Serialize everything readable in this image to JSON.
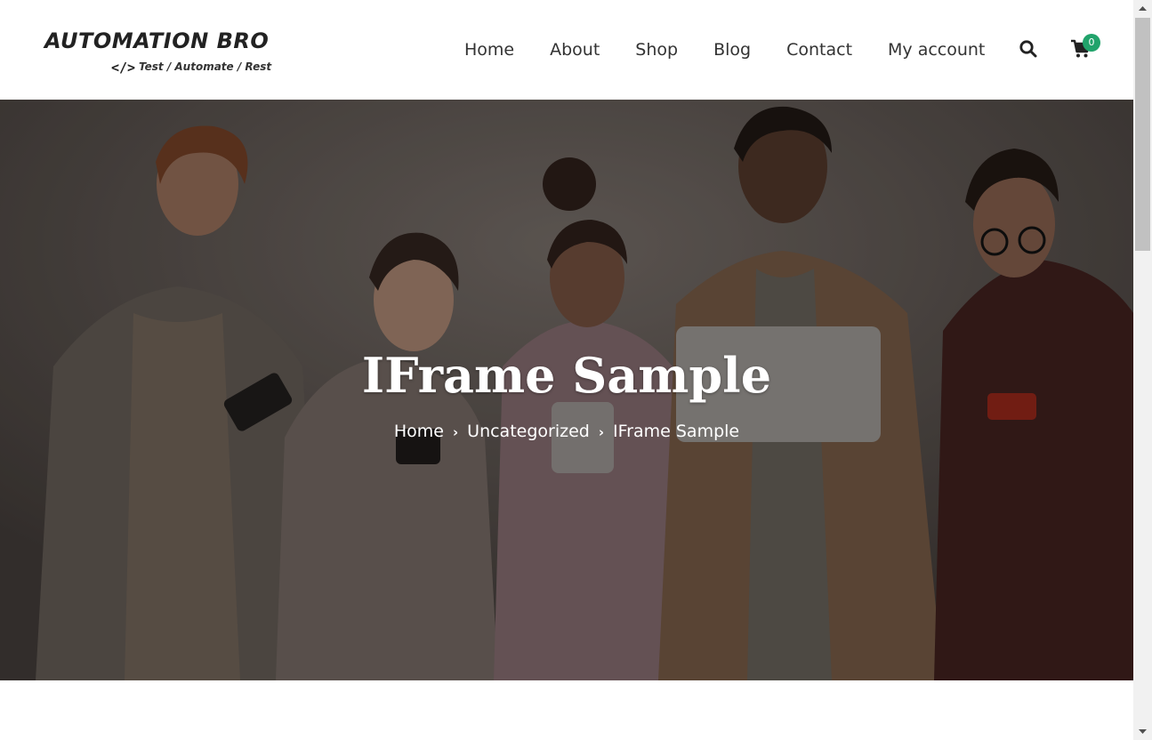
{
  "logo": {
    "title": "AUTOMATION BRO",
    "code_symbol": "</>",
    "tagline": "Test / Automate / Rest"
  },
  "nav": {
    "items": [
      "Home",
      "About",
      "Shop",
      "Blog",
      "Contact",
      "My account"
    ]
  },
  "header": {
    "search_icon": "search-icon",
    "cart_icon": "cart-icon",
    "cart_count": "0",
    "accent_color": "#21a36b"
  },
  "hero": {
    "title": "IFrame Sample",
    "breadcrumb": {
      "items": [
        "Home",
        "Uncategorized",
        "IFrame Sample"
      ],
      "separator": "›"
    }
  }
}
